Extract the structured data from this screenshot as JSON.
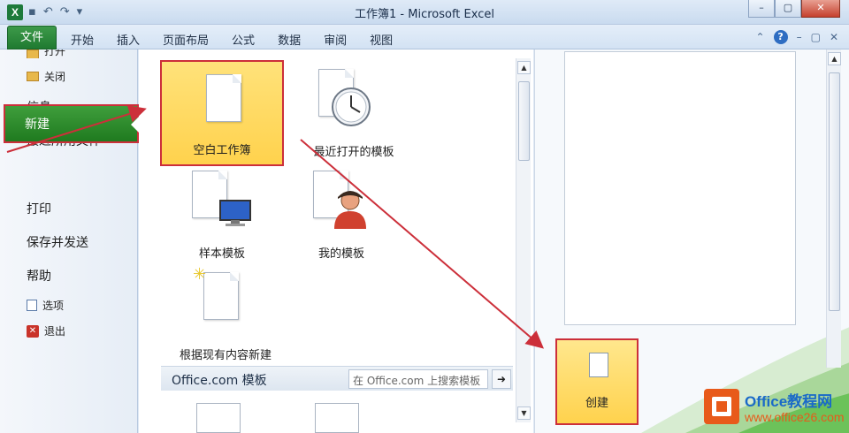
{
  "window": {
    "title": "工作簿1 - Microsoft Excel",
    "app_icon": "X",
    "controls": {
      "minimize": "–",
      "restore": "▢",
      "close": "✕"
    }
  },
  "ribbon": {
    "file_tab": "文件",
    "tabs": [
      "开始",
      "插入",
      "页面布局",
      "公式",
      "数据",
      "审阅",
      "视图"
    ]
  },
  "nav": {
    "open_partial": "打开",
    "close": "关闭",
    "info": "信息",
    "recent": "最近所用文件",
    "new": "新建",
    "print": "打印",
    "save_send": "保存并发送",
    "help": "帮助",
    "options": "选项",
    "exit": "退出"
  },
  "templates": {
    "blank": "空白工作簿",
    "recent": "最近打开的模板",
    "sample": "样本模板",
    "mine": "我的模板",
    "from_existing": "根据现有内容新建"
  },
  "office_com": {
    "title": "Office.com 模板",
    "search_placeholder": "在 Office.com 上搜索模板"
  },
  "right": {
    "create": "创建"
  },
  "watermark": {
    "line1": "Office教程网",
    "line2": "www.office26.com"
  },
  "colors": {
    "accent_green": "#1f7a31",
    "highlight_yellow": "#ffd24d",
    "annotation_red": "#cc2f3a"
  }
}
